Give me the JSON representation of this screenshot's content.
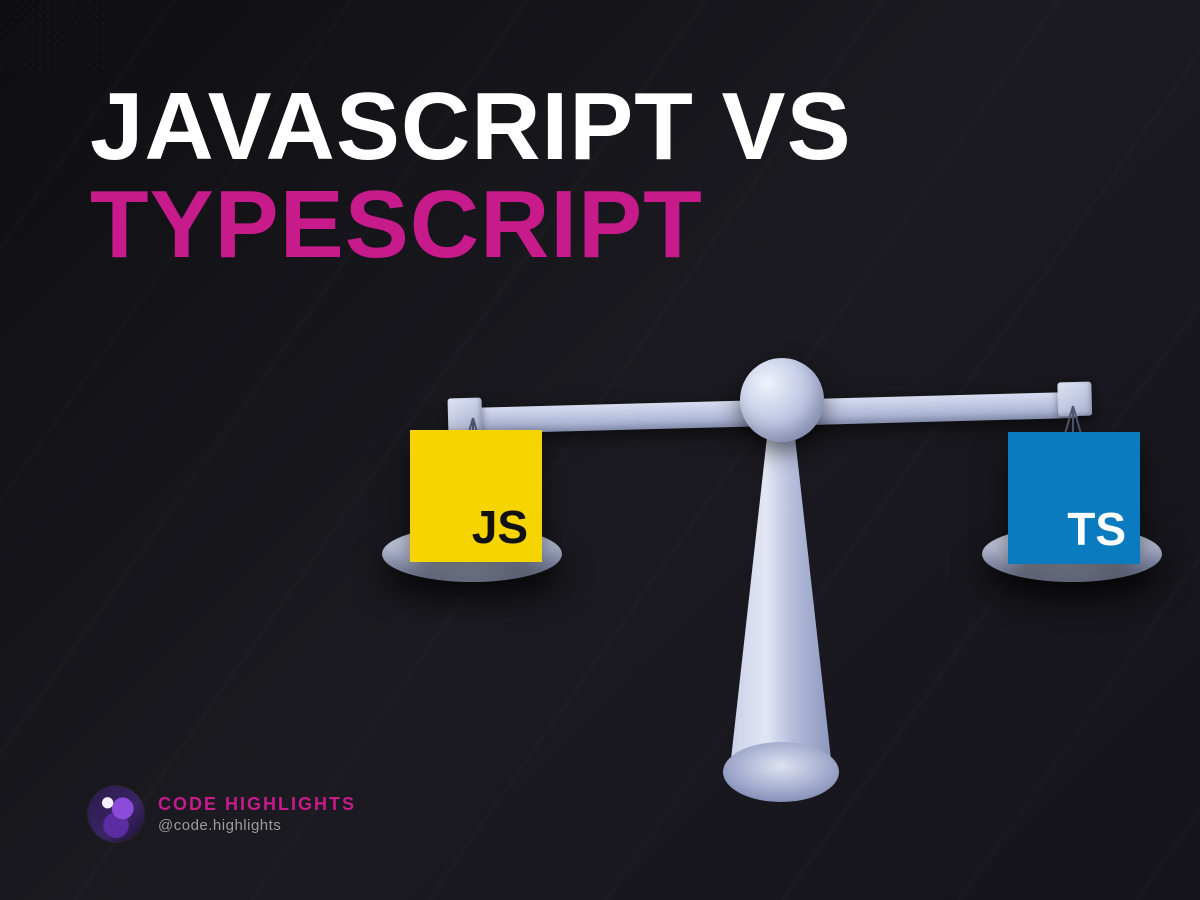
{
  "headline": {
    "line1": "JAVASCRIPT VS",
    "line2": "TYPESCRIPT"
  },
  "tiles": {
    "js_label": "JS",
    "ts_label": "TS"
  },
  "attribution": {
    "brand": "CODE HIGHLIGHTS",
    "handle": "@code.highlights"
  },
  "colors": {
    "accent_pink": "#c71a8b",
    "js_yellow": "#f6d400",
    "ts_blue": "#0b7bc0",
    "scale_light": "#d7ddf0"
  }
}
